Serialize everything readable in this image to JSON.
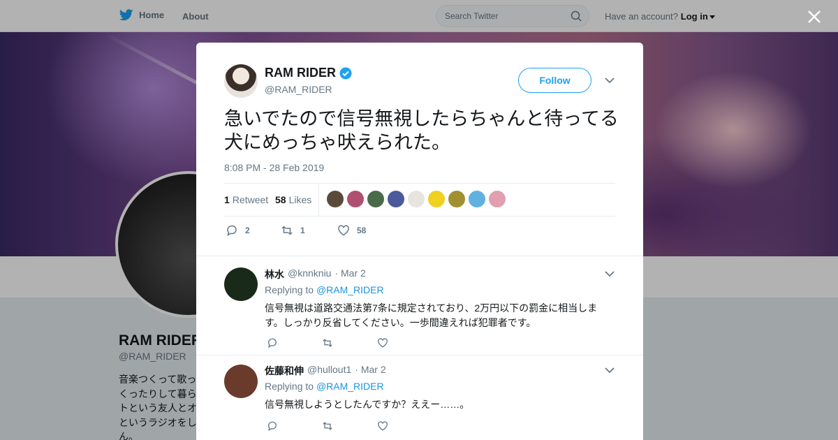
{
  "topbar": {
    "home_label": "Home",
    "about_label": "About",
    "search_placeholder": "Search Twitter",
    "account_prompt": "Have an account?",
    "login_label": "Log in",
    "brand_color": "#1da1f2"
  },
  "profile": {
    "name": "RAM RIDER",
    "handle": "@RAM_RIDER",
    "bio": "音楽つくって歌っ\nくったりして暮ら\nトという友人とオ\nというラジオをし\nん。"
  },
  "tweet": {
    "author_name": "RAM RIDER",
    "author_handle": "@RAM_RIDER",
    "follow_label": "Follow",
    "text": "急いでたので信号無視したらちゃんと待ってる犬にめっちゃ吠えられた。",
    "timestamp": "8:08 PM - 28 Feb 2019",
    "retweets_count": "1",
    "retweets_label": "Retweet",
    "likes_count": "58",
    "likes_label": "Likes",
    "reply_count": "2",
    "retweet_action_count": "1",
    "like_action_count": "58",
    "liker_colors": [
      "#5a4a3a",
      "#b05070",
      "#4a6a4a",
      "#4a5a9a",
      "#e8e4e0",
      "#f0d020",
      "#a09030",
      "#60b0e0",
      "#e0a0b0"
    ]
  },
  "replies": [
    {
      "name": "林水",
      "handle": "@knnkniu",
      "date": "· Mar 2",
      "replying_prefix": "Replying to",
      "replying_to": "@RAM_RIDER",
      "text": "信号無視は道路交通法第7条に規定されており、2万円以下の罰金に相当します。しっかり反省してください。一歩間違えれば犯罪者です。",
      "avatar_color": "#1a2a1a"
    },
    {
      "name": "佐藤和伸",
      "handle": "@hullout1",
      "date": "· Mar 2",
      "replying_prefix": "Replying to",
      "replying_to": "@RAM_RIDER",
      "text": "信号無視しようとしたんですか？ええー……。",
      "avatar_color": "#6a3a2a"
    }
  ]
}
